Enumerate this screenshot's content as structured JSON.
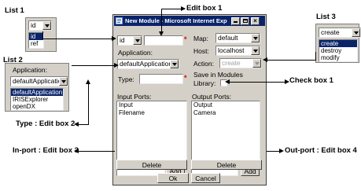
{
  "annotations": {
    "list1": "List 1",
    "list2": "List 2",
    "list3": "List 3",
    "edit_box1": "Edit box 1",
    "edit_box2": "Type : Edit box 2",
    "edit_box3": "In-port : Edit box 3",
    "edit_box4": "Out-port : Edit box 4",
    "check_box1": "Check box 1"
  },
  "list1_popup": {
    "selected": "id",
    "options": [
      "id",
      "ref"
    ]
  },
  "list2_popup": {
    "caption": "Application:",
    "selected": "defaultApplication",
    "options": [
      "defaultApplication",
      "IRISExplorer",
      "openDX"
    ]
  },
  "list3_popup": {
    "selected": "create",
    "options": [
      "create",
      "destroy",
      "modify"
    ]
  },
  "dialog": {
    "title": "New Module - Microsoft Internet Explo...",
    "id_select": "id",
    "id_input": "",
    "application_label": "Application:",
    "application_select": "defaultApplication",
    "type_label": "Type:",
    "type_input": "",
    "map_label": "Map:",
    "map_select": "default",
    "host_label": "Host:",
    "host_select": "localhost",
    "action_label": "Action:",
    "action_select": "create",
    "save_label": "Save in Modules",
    "library_label": "Library:",
    "library_checked": false,
    "input_ports_label": "Input Ports:",
    "input_ports": [
      "Input",
      "Filename"
    ],
    "output_ports_label": "Output Ports:",
    "output_ports": [
      "Output",
      "Camera"
    ],
    "inport_input": "",
    "outport_input": "",
    "add_label": "Add",
    "delete_label": "Delete",
    "ok_label": "Ok",
    "cancel_label": "Cancel",
    "required_mark": "*"
  }
}
